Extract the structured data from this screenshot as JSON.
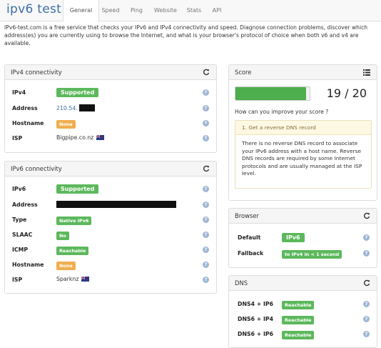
{
  "brand": "ipv6 test",
  "nav": {
    "tabs": [
      {
        "label": "General",
        "active": true
      },
      {
        "label": "Speed"
      },
      {
        "label": "Ping"
      },
      {
        "label": "Website"
      },
      {
        "label": "Stats"
      },
      {
        "label": "API"
      }
    ]
  },
  "intro": "IPv6-test.com is a free service that checks your IPv6 and IPv4 connectivity and speed. Diagnose connection problems, discover which address(es) you are currently using to browse the Internet, and what is your browser's protocol of choice when both v6 and v4 are available.",
  "ipv4": {
    "title": "IPv4 connectivity",
    "rows": [
      {
        "label": "IPv4",
        "value": "Supported"
      },
      {
        "label": "Address",
        "value": "210.54."
      },
      {
        "label": "Hostname",
        "value": "None"
      },
      {
        "label": "ISP",
        "value": "Bigpipe.co.nz"
      }
    ]
  },
  "ipv6": {
    "title": "IPv6 connectivity",
    "rows": [
      {
        "label": "IPv6",
        "value": "Supported"
      },
      {
        "label": "Address",
        "value": ""
      },
      {
        "label": "Type",
        "value": "Native IPv6"
      },
      {
        "label": "SLAAC",
        "value": "No"
      },
      {
        "label": "ICMP",
        "value": "Reachable"
      },
      {
        "label": "Hostname",
        "value": "None"
      },
      {
        "label": "ISP",
        "value": "Sparknz"
      }
    ]
  },
  "score": {
    "title": "Score",
    "value": "19 / 20",
    "fraction": 0.95,
    "question": "How can you improve your score ?",
    "tip_title": "1. Get a reverse DNS record",
    "tip_body": "There is no reverse DNS record to associate your IPv6 address with a host name. Reverse DNS records are required by some Internet protocols and are usually managed at the ISP level."
  },
  "browser": {
    "title": "Browser",
    "rows": [
      {
        "label": "Default",
        "value": "IPv6"
      },
      {
        "label": "Fallback",
        "value": "to IPv4 in < 1 second"
      }
    ]
  },
  "dns": {
    "title": "DNS",
    "rows": [
      {
        "label": "DNS4 + IP6",
        "value": "Reachable"
      },
      {
        "label": "DNS6 + IP4",
        "value": "Reachable"
      },
      {
        "label": "DNS6 + IP6",
        "value": "Reachable"
      }
    ]
  },
  "colors": {
    "brand": "#3a6ea5",
    "success": "#5cb85c",
    "warning": "#f0ad4e",
    "help_icon": "#9fb6d4"
  },
  "help_glyph": "?"
}
